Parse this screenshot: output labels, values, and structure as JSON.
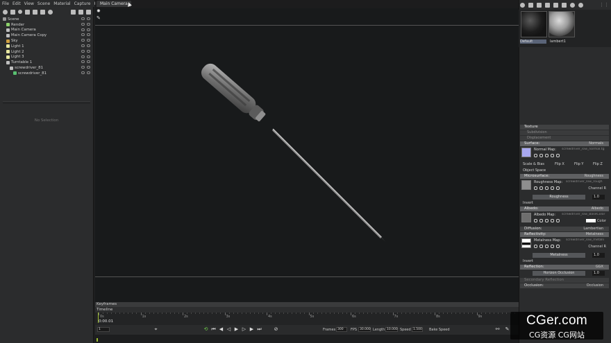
{
  "menu": [
    "File",
    "Edit",
    "View",
    "Scene",
    "Material",
    "Capture",
    "Help"
  ],
  "scene_tree": [
    {
      "label": "Scene",
      "indent": 0,
      "icon": "scene-icon",
      "color": "#9a9a9a"
    },
    {
      "label": "Render",
      "indent": 1,
      "icon": "render-icon",
      "color": "#8bd06a"
    },
    {
      "label": "Main Camera",
      "indent": 1,
      "icon": "camera-icon",
      "color": "#bfbfbf"
    },
    {
      "label": "Main Camera Copy",
      "indent": 1,
      "icon": "camera-icon",
      "color": "#bfbfbf"
    },
    {
      "label": "Sky",
      "indent": 1,
      "icon": "sky-icon",
      "color": "#d0a040"
    },
    {
      "label": "Light 1",
      "indent": 1,
      "icon": "light-icon",
      "color": "#e8e8a0"
    },
    {
      "label": "Light 2",
      "indent": 1,
      "icon": "light-icon",
      "color": "#e8e8a0"
    },
    {
      "label": "Light 3",
      "indent": 1,
      "icon": "light-icon",
      "color": "#e8e8a0"
    },
    {
      "label": "Turntable 1",
      "indent": 1,
      "icon": "turntable-icon",
      "color": "#bfbfbf"
    },
    {
      "label": "screwdriver_81",
      "indent": 2,
      "icon": "mesh-icon",
      "color": "#bfbfbf"
    },
    {
      "label": "screwdriver_81",
      "indent": 3,
      "icon": "submesh-icon",
      "color": "#59c070"
    }
  ],
  "no_selection": "No Selection",
  "viewport": {
    "tab_label": "Main Camera"
  },
  "timeline": {
    "keyframes_label": "Keyframes",
    "timeline_label": "Timeline",
    "ticks": [
      "0s",
      "1s",
      "2s",
      "3s",
      "4s",
      "5s",
      "6s",
      "7s",
      "8s",
      "9s"
    ],
    "current_time": "0:00.01",
    "frame_value": "1",
    "frames_label": "Frames",
    "frames_value": "300",
    "fps_label": "FPS",
    "fps_value": "30.000",
    "length_label": "Length",
    "length_value": "10.000",
    "speed_label": "Speed",
    "speed_value": "1.500",
    "bake_label": "Bake Speed"
  },
  "materials": [
    {
      "label": "Default",
      "selected": true
    },
    {
      "label": "lambert1",
      "selected": false
    }
  ],
  "properties": {
    "texture": "Texture",
    "subdivision": "Subdivision",
    "displacement": "Displacement",
    "surface": {
      "title": "Surface:",
      "value": "Normals"
    },
    "normal_map": {
      "label": "Normal Map:",
      "file": "screwdriver_low_normal.tg",
      "swatch": "#a8a8f0"
    },
    "scale_bias": "Scale & Bias",
    "flip_x": "Flip X",
    "flip_y": "Flip Y",
    "flip_z": "Flip Z",
    "object_space": "Object Space",
    "microsurface": {
      "title": "Microsurface:",
      "value": "Roughness"
    },
    "roughness_map": {
      "label": "Roughness Map:",
      "file": "screwdriver_low_rough",
      "channel": "Channel",
      "channel_value": "R",
      "swatch": "#8e8e8e"
    },
    "roughness": {
      "label": "Roughness",
      "value": "1.0",
      "level": 1.0
    },
    "invert_1": "Invert",
    "albedo": {
      "title": "Albedo:",
      "value": "Albedo"
    },
    "albedo_map": {
      "label": "Albedo Map:",
      "file": "screwdriver_low_BaseColor",
      "color_label": "Color",
      "swatch": "#6e6e6e"
    },
    "diffusion": {
      "title": "Diffusion:",
      "value": "Lambertian"
    },
    "reflectivity": {
      "title": "Reflectivity:",
      "value": "Metalness"
    },
    "metalness_map": {
      "label": "Metalness Map:",
      "file": "screwdriver_low_metalli",
      "channel": "Channel",
      "channel_value": "R",
      "swatch": "#222222"
    },
    "metalness": {
      "label": "Metalness",
      "value": "1.0",
      "level": 1.0
    },
    "invert_2": "Invert",
    "reflection": {
      "title": "Reflection:",
      "value": "GGX"
    },
    "horizon": {
      "label": "Horizon Occlusion",
      "value": "1.0",
      "level": 1.0
    },
    "secondary": "Secondary Reflection",
    "occlusion": {
      "title": "Occlusion:",
      "value": "Occlusion"
    }
  },
  "watermark": {
    "main": "CGer.com",
    "sub": "CG资源 CG网站"
  },
  "colors": {
    "accent_green": "#9fbf30",
    "selection_blue": "#5a6478",
    "panel": "#2b2c2d",
    "viewport": "#181a1b"
  }
}
